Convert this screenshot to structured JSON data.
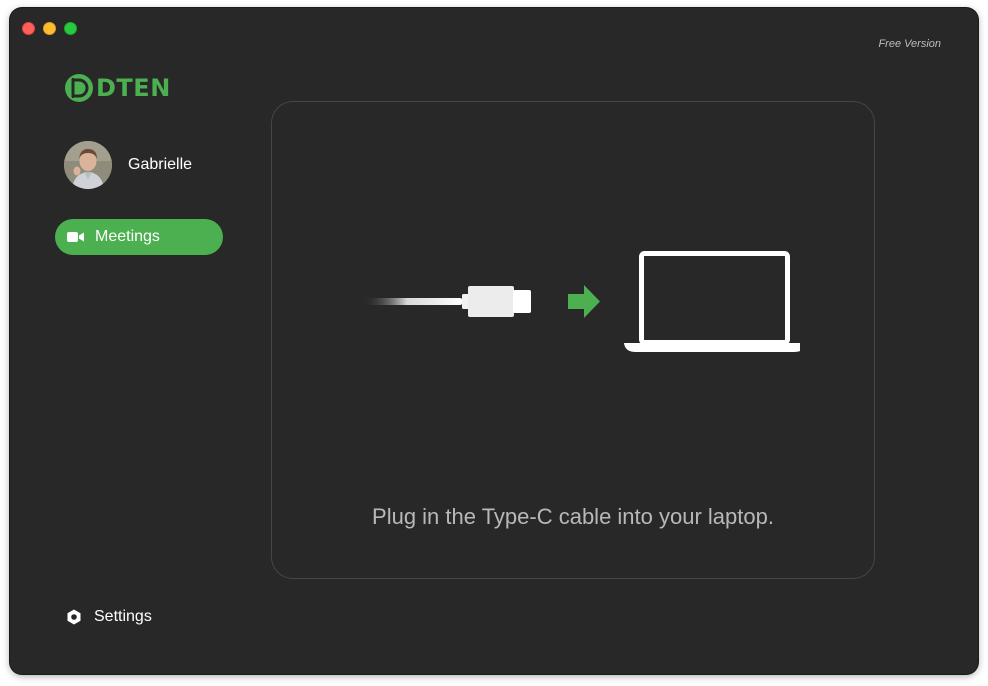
{
  "window": {
    "controls": [
      "close",
      "minimize",
      "zoom"
    ]
  },
  "header": {
    "version_label": "Free Version"
  },
  "sidebar": {
    "logo_text": "DTEN",
    "user": {
      "name": "Gabrielle",
      "avatar_icon": "user-photo"
    },
    "nav": [
      {
        "label": "Meetings",
        "icon": "video-camera-icon",
        "active": true
      }
    ],
    "settings_label": "Settings",
    "settings_icon": "gear-icon"
  },
  "main": {
    "illustration": {
      "items": [
        "usb-c-cable-icon",
        "arrow-right-icon",
        "laptop-icon"
      ]
    },
    "instruction": "Plug in the Type-C cable into your laptop."
  },
  "colors": {
    "accent": "#4caf50",
    "background": "#282828",
    "panel_border": "#464646",
    "text_primary": "#ffffff",
    "text_secondary": "#b8b8b8"
  }
}
